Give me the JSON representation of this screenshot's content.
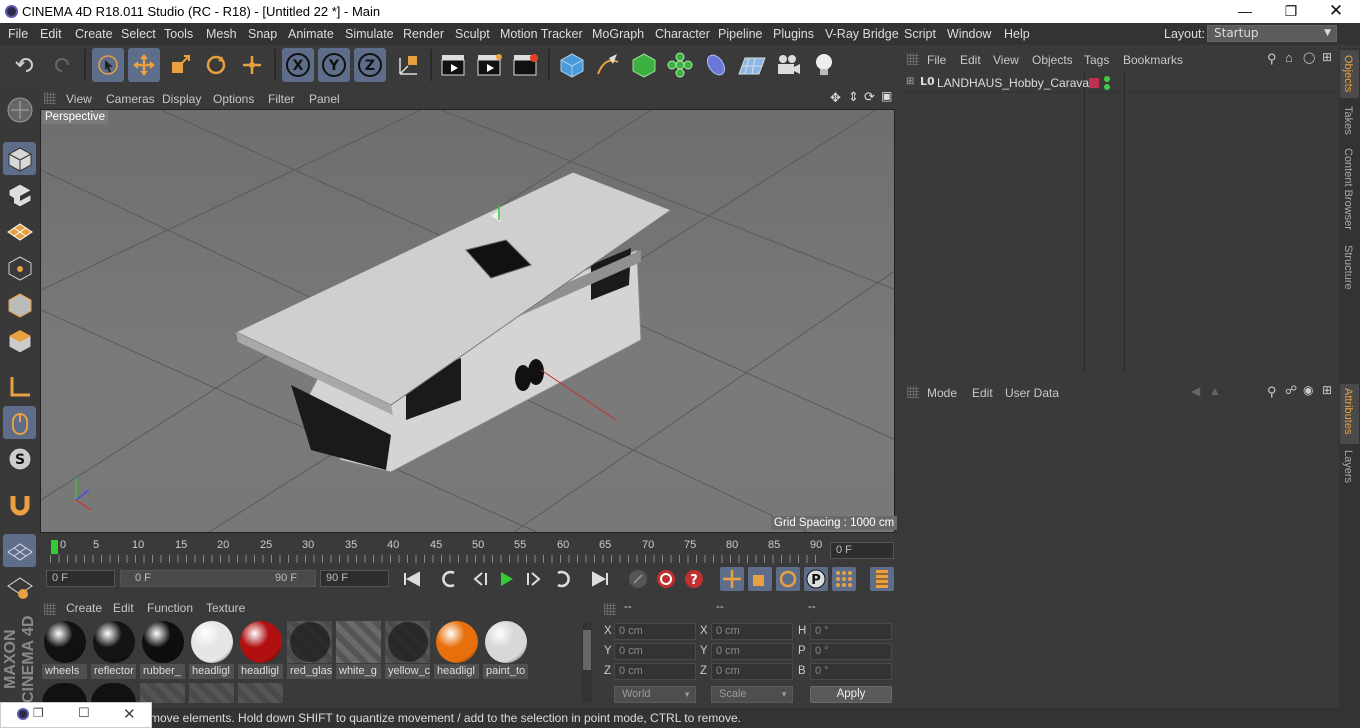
{
  "window": {
    "title": "CINEMA 4D R18.011 Studio (RC - R18) - [Untitled 22 *] - Main",
    "controls": [
      "minimize",
      "restore",
      "close"
    ]
  },
  "menubar": {
    "items": [
      "File",
      "Edit",
      "Create",
      "Select",
      "Tools",
      "Mesh",
      "Snap",
      "Animate",
      "Simulate",
      "Render",
      "Sculpt",
      "Motion Tracker",
      "MoGraph",
      "Character",
      "Pipeline",
      "Plugins",
      "V-Ray Bridge",
      "Script",
      "Window",
      "Help"
    ],
    "layout_label": "Layout:",
    "layout_value": "Startup"
  },
  "viewport": {
    "menu": [
      "View",
      "Cameras",
      "Display",
      "Options",
      "Filter",
      "Panel"
    ],
    "label": "Perspective",
    "grid_spacing": "Grid Spacing : 1000 cm"
  },
  "timeline": {
    "ticks": [
      "0",
      "5",
      "10",
      "15",
      "20",
      "25",
      "30",
      "35",
      "40",
      "45",
      "50",
      "55",
      "60",
      "65",
      "70",
      "75",
      "80",
      "85",
      "90"
    ],
    "current_frame": "0 F",
    "start_field": "0 F",
    "range_start": "0 F",
    "range_end": "90 F",
    "end_field": "90 F"
  },
  "materials": {
    "menu": [
      "Create",
      "Edit",
      "Function",
      "Texture"
    ],
    "items": [
      {
        "name": "wheels",
        "color": "#111111",
        "type": "solid"
      },
      {
        "name": "reflector",
        "color": "#141414",
        "type": "solid"
      },
      {
        "name": "rubber_",
        "color": "#0e0e0e",
        "type": "solid"
      },
      {
        "name": "headligl",
        "color": "#e6e6e6",
        "type": "solid"
      },
      {
        "name": "headligl",
        "color": "#b01010",
        "type": "solid"
      },
      {
        "name": "red_glas",
        "color": "#3a3a3a",
        "type": "glass"
      },
      {
        "name": "white_g",
        "color": "#777777",
        "type": "stripe"
      },
      {
        "name": "yellow_c",
        "color": "#3a3a3a",
        "type": "glass"
      },
      {
        "name": "headligl",
        "color": "#e8700c",
        "type": "solid"
      },
      {
        "name": "paint_to",
        "color": "#d8d8d8",
        "type": "solid"
      }
    ]
  },
  "coords": {
    "headers": [
      "--",
      "--",
      "--"
    ],
    "rows": [
      {
        "l1": "X",
        "v1": "0 cm",
        "l2": "X",
        "v2": "0 cm",
        "l3": "H",
        "v3": "0 °"
      },
      {
        "l1": "Y",
        "v1": "0 cm",
        "l2": "Y",
        "v2": "0 cm",
        "l3": "P",
        "v3": "0 °"
      },
      {
        "l1": "Z",
        "v1": "0 cm",
        "l2": "Z",
        "v2": "0 cm",
        "l3": "B",
        "v3": "0 °"
      }
    ],
    "mode": "World",
    "transform": "Scale",
    "apply": "Apply"
  },
  "objects": {
    "menu": [
      "File",
      "Edit",
      "View",
      "Objects",
      "Tags",
      "Bookmarks"
    ],
    "tree": [
      {
        "name": "LANDHAUS_Hobby_Caravan"
      }
    ]
  },
  "attributes": {
    "menu": [
      "Mode",
      "Edit",
      "User Data"
    ]
  },
  "side_tabs": {
    "top": [
      "Objects",
      "Takes",
      "Content Browser",
      "Structure"
    ],
    "bottom": [
      "Attributes",
      "Layers"
    ]
  },
  "status": "move elements. Hold down SHIFT to quantize movement / add to the selection in point mode, CTRL to remove.",
  "brand": "MAXON CINEMA 4D",
  "colors": {
    "selection": "#5d6d8a",
    "accent": "#e8a040",
    "background": "#3a3a3a"
  }
}
